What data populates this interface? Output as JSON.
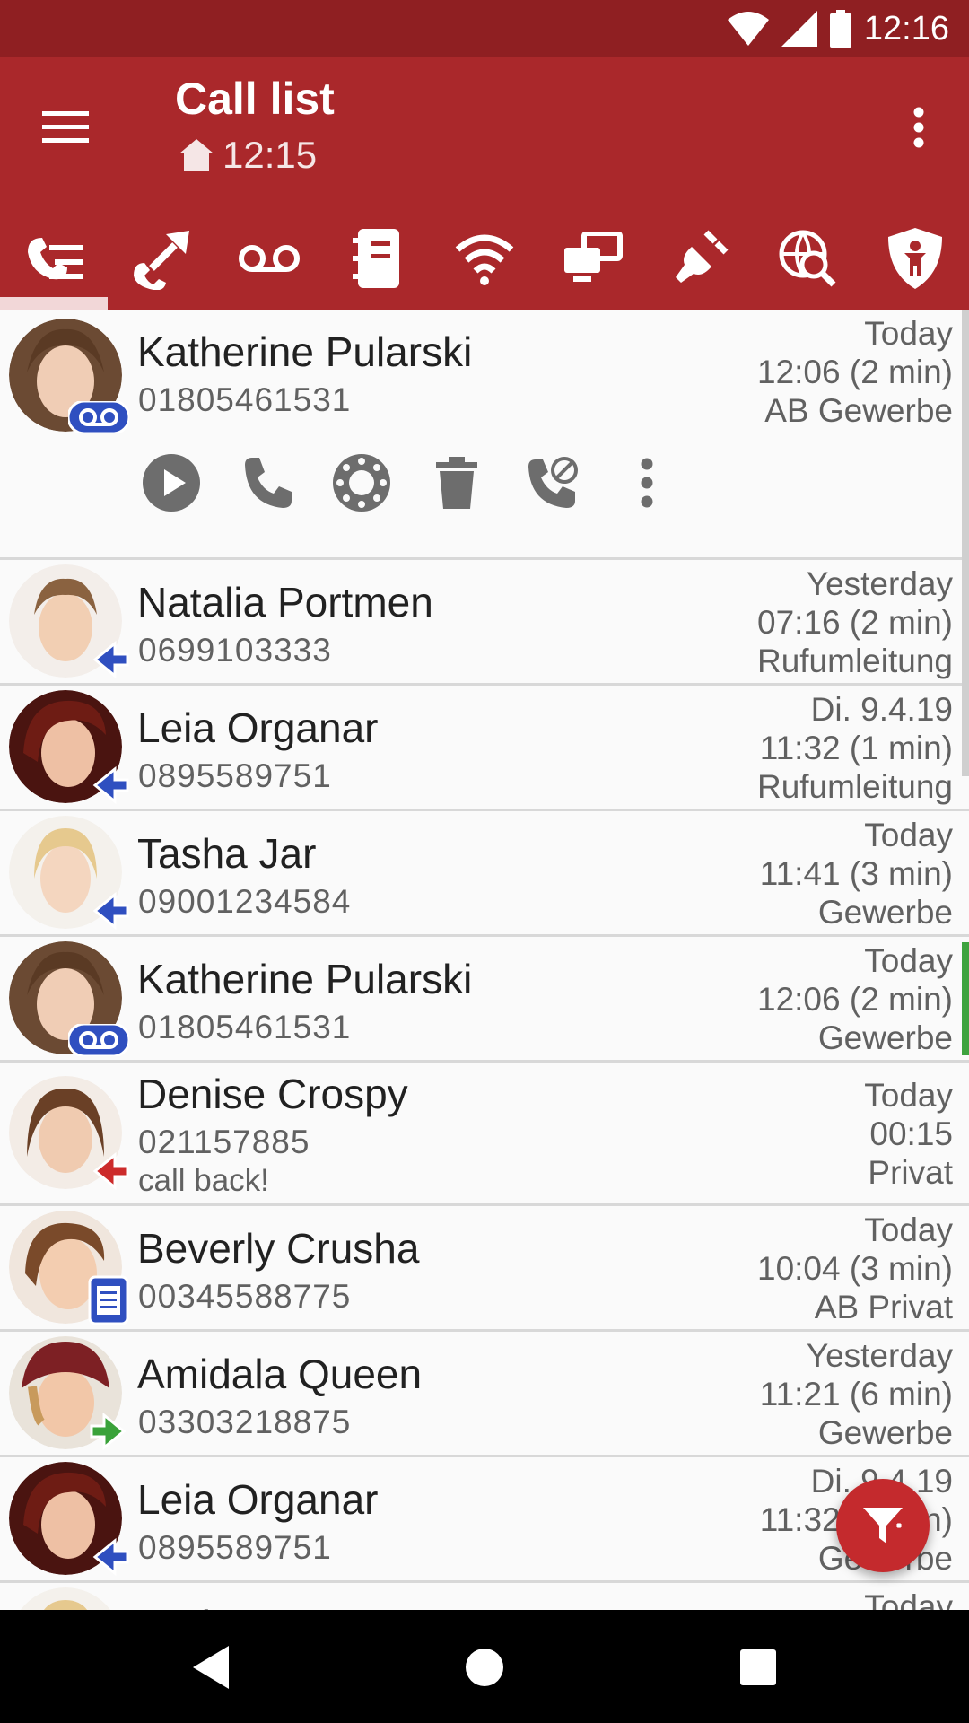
{
  "status_bar": {
    "time": "12:16",
    "icons": [
      "wifi-icon",
      "signal-icon",
      "battery-icon"
    ]
  },
  "app_bar": {
    "title": "Call list",
    "subtitle_time": "12:15",
    "menu_icon": "hamburger-menu-icon",
    "overflow_icon": "more-vertical-icon",
    "background": "#aa282b",
    "status_background": "#8f1f22"
  },
  "tabs": [
    {
      "icon": "call-list-icon",
      "active": true
    },
    {
      "icon": "call-divert-icon"
    },
    {
      "icon": "voicemail-icon"
    },
    {
      "icon": "phonebook-icon"
    },
    {
      "icon": "wifi-icon"
    },
    {
      "icon": "network-devices-icon"
    },
    {
      "icon": "plug-icon"
    },
    {
      "icon": "web-search-icon"
    },
    {
      "icon": "child-protection-icon"
    }
  ],
  "calls": [
    {
      "name": "Katherine Pularski",
      "number": "01805461531",
      "day": "Today",
      "time": "12:06 (2 min)",
      "line": "AB Gewerbe",
      "type": "voicemail",
      "expanded": true,
      "highlight": true
    },
    {
      "name": "Natalia Portmen",
      "number": "0699103333",
      "day": "Yesterday",
      "time": "07:16 (2 min)",
      "line": "Rufumleitung",
      "type": "incoming"
    },
    {
      "name": "Leia Organar",
      "number": "0895589751",
      "day": "Di. 9.4.19",
      "time": "11:32 (1 min)",
      "line": "Rufumleitung",
      "type": "incoming"
    },
    {
      "name": "Tasha Jar",
      "number": "09001234584",
      "day": "Today",
      "time": "11:41 (3 min)",
      "line": "Gewerbe",
      "type": "incoming"
    },
    {
      "name": "Katherine Pularski",
      "number": "01805461531",
      "day": "Today",
      "time": "12:06 (2 min)",
      "line": "Gewerbe",
      "type": "voicemail",
      "highlight": true
    },
    {
      "name": "Denise Crospy",
      "number": "021157885",
      "note": "call back!",
      "day": "Today",
      "time": "00:15",
      "line": "Privat",
      "type": "missed"
    },
    {
      "name": "Beverly Crusha",
      "number": "00345588775",
      "day": "Today",
      "time": "10:04 (3 min)",
      "line": "AB Privat",
      "type": "fax"
    },
    {
      "name": "Amidala Queen",
      "number": "03303218875",
      "day": "Yesterday",
      "time": "11:21 (6 min)",
      "line": "Gewerbe",
      "type": "outgoing"
    },
    {
      "name": "Leia Organar",
      "number": "0895589751",
      "day": "Di. 9.4.19",
      "time": "11:32 (1 min)",
      "line": "Gewerbe",
      "type": "incoming"
    },
    {
      "name": "Tasha Jar",
      "number": "",
      "day": "Today",
      "time": "",
      "line": "",
      "type": "incoming"
    }
  ],
  "expanded_actions": [
    "play-icon",
    "call-icon",
    "dialpad-icon",
    "delete-icon",
    "block-call-icon",
    "more-vertical-icon"
  ],
  "fab": {
    "icon": "filter-icon"
  },
  "nav_bar": [
    "back-icon",
    "home-icon",
    "recents-icon"
  ],
  "colors": {
    "incoming": "#2f4fc0",
    "missed": "#cc2b2b",
    "outgoing": "#3aa23a",
    "highlight": "#3fa33f"
  }
}
